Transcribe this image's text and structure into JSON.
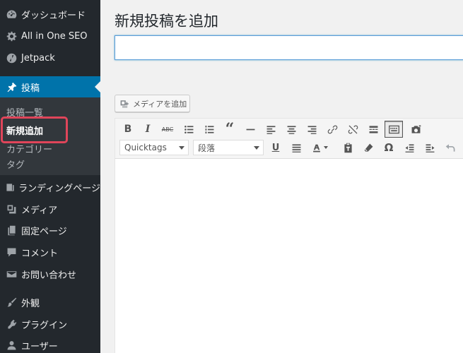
{
  "sidebar": {
    "menu": [
      {
        "label": "ダッシュボード",
        "icon": "dashboard-icon"
      },
      {
        "label": "All in One SEO",
        "icon": "gear-icon"
      },
      {
        "label": "Jetpack",
        "icon": "jetpack-icon"
      },
      {
        "label": "投稿",
        "icon": "pin-icon",
        "current": true
      },
      {
        "label": "ランディングページ",
        "icon": "landing-page-icon"
      },
      {
        "label": "メディア",
        "icon": "media-icon"
      },
      {
        "label": "固定ページ",
        "icon": "page-icon"
      },
      {
        "label": "コメント",
        "icon": "comment-icon"
      },
      {
        "label": "お問い合わせ",
        "icon": "mail-icon"
      },
      {
        "label": "外観",
        "icon": "brush-icon"
      },
      {
        "label": "プラグイン",
        "icon": "plugin-icon"
      },
      {
        "label": "ユーザー",
        "icon": "user-icon"
      }
    ],
    "submenu": [
      {
        "label": "投稿一覧"
      },
      {
        "label": "新規追加",
        "active": true
      },
      {
        "label": "カテゴリー"
      },
      {
        "label": "タグ"
      }
    ],
    "highlight_color": "#e0455a"
  },
  "main": {
    "title": "新規投稿を追加",
    "title_input_value": "",
    "add_media_label": "メディアを追加",
    "toolbar": {
      "format_select": "Quicktags",
      "paragraph_select": "段落",
      "row1_icons": [
        "bold-icon",
        "italic-icon",
        "strikethrough-icon",
        "bullet-list-icon",
        "numbered-list-icon",
        "blockquote-icon",
        "horizontal-line-icon",
        "align-left-icon",
        "align-center-icon",
        "align-right-icon",
        "link-icon",
        "unlink-icon",
        "read-more-icon",
        "toolbar-toggle-icon",
        "camera-icon"
      ],
      "row2_icons": [
        "underline-icon",
        "justify-icon",
        "text-color-icon",
        "paste-text-icon",
        "clear-formatting-icon",
        "special-character-icon",
        "outdent-icon",
        "indent-icon",
        "undo-icon"
      ],
      "text_color_accent": "#0073aa"
    }
  }
}
